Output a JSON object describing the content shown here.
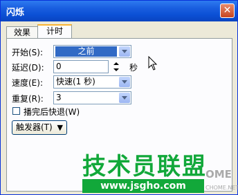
{
  "window": {
    "title": "闪烁",
    "close_icon": "close-icon"
  },
  "tabs": [
    {
      "label": "效果",
      "active": false
    },
    {
      "label": "计时",
      "active": true
    }
  ],
  "form": {
    "start_label": "开始(S):",
    "start_value": "之前",
    "delay_label": "延迟(D):",
    "delay_value": "0",
    "delay_unit": "秒",
    "speed_label": "速度(E):",
    "speed_value": "快速(1 秒)",
    "repeat_label": "重复(R):",
    "repeat_value": "3",
    "rewind_label": "播完后快退(W)",
    "rewind_checked": false,
    "trigger_label": "触发器(T)",
    "trigger_icon": "double-chevron-down-icon"
  },
  "watermark": {
    "text": "技术员联盟",
    "url": "www.jsgho.com",
    "corner_logo": "OME",
    "corner_sub": "CHOME.NET"
  },
  "colors": {
    "title_bar": "#0b4fd4",
    "selection": "#316ac5",
    "dialog_bg": "#ece9d8",
    "watermark_green": "#12a83a"
  }
}
